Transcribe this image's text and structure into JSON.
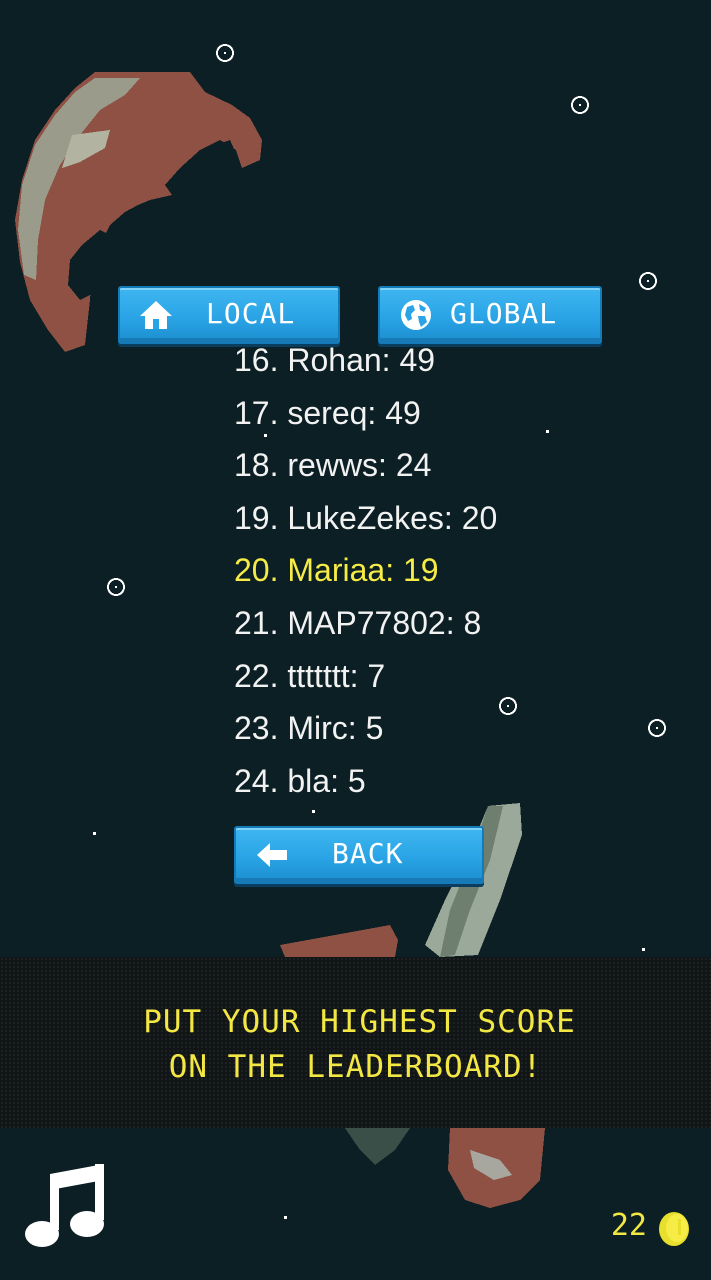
{
  "tabs": {
    "local_label": "LOCAL",
    "global_label": "GLOBAL"
  },
  "leaderboard": [
    {
      "text": "16. Rohan: 49",
      "highlight": false
    },
    {
      "text": "17. sereq: 49",
      "highlight": false
    },
    {
      "text": "18. rewws: 24",
      "highlight": false
    },
    {
      "text": "19. LukeZekes: 20",
      "highlight": false
    },
    {
      "text": "20. Mariaa: 19",
      "highlight": true
    },
    {
      "text": "21. MAP77802: 8",
      "highlight": false
    },
    {
      "text": "22. ttttttt: 7",
      "highlight": false
    },
    {
      "text": "23. Mirc: 5",
      "highlight": false
    },
    {
      "text": "24. bla: 5",
      "highlight": false
    }
  ],
  "back_label": "BACK",
  "banner": {
    "line1": "PUT YOUR HIGHEST SCORE",
    "line2": "ON THE LEADERBOARD!"
  },
  "coins": "22",
  "icons": {
    "local": "home-icon",
    "global": "globe-icon",
    "back": "arrow-left-icon",
    "music": "music-note-icon",
    "coin": "coin-icon"
  },
  "colors": {
    "background": "#0c1f24",
    "button": "#2aa4e6",
    "highlight": "#f6ec45",
    "banner_text": "#f3e843"
  }
}
